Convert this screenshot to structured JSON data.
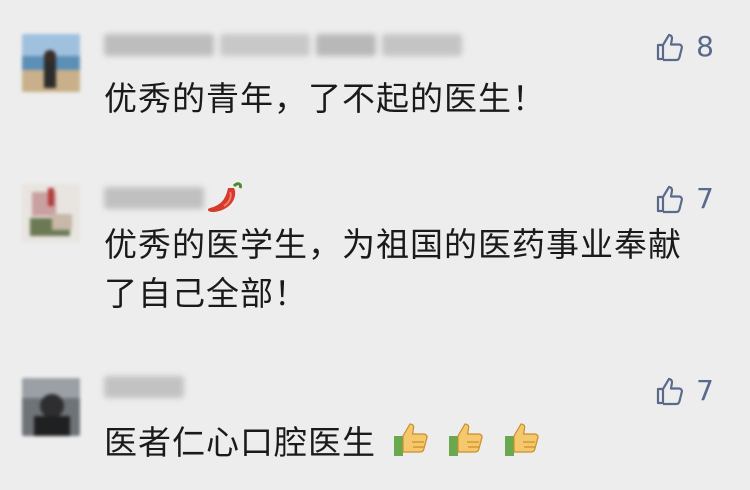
{
  "comments": [
    {
      "text": "优秀的青年，了不起的医生！",
      "likes": "8"
    },
    {
      "text": "优秀的医学生，为祖国的医药事业奉献了自己全部！",
      "likes": "7"
    },
    {
      "text": "医者仁心口腔医生",
      "likes": "7"
    }
  ],
  "colors": {
    "background": "#ededed",
    "like_color": "#5a6a8c",
    "text_color": "#1a1a1a"
  },
  "icons": {
    "like": "thumbs-up-outline-icon",
    "chili": "chili-pepper-emoji",
    "thumbs": "thumbs-up-emoji"
  }
}
